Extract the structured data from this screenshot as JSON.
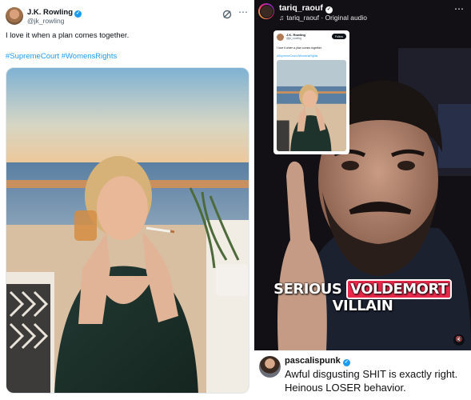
{
  "tweet": {
    "name": "J.K. Rowling",
    "handle": "@jk_rowling",
    "text": "I love it when a plan comes together.",
    "hashtags": "#SupremeCourt #WomensRights",
    "more_icon": "⋯",
    "verified_icon": "✓"
  },
  "reel": {
    "username": "tariq_raouf",
    "audio_note": "♫",
    "audio": "tariq_raouf · Original audio",
    "more_icon": "⋯",
    "verified_icon": "✓",
    "caption_pre": "SERIOUS ",
    "caption_highlight": "VOLDEMORT",
    "caption_post": " VILLAIN",
    "mute_icon": "🔇",
    "embedded": {
      "name": "J.K. Rowling",
      "handle": "@jk_rowling",
      "follow": "Follow",
      "text": "I love it when a plan comes together.",
      "hashtags": "#SupremeCourt #WomensRights"
    }
  },
  "comment": {
    "username": "pascalispunk",
    "verified_icon": "✓",
    "text": "Awful disgusting SHIT is exactly right. Heinous LOSER behavior."
  },
  "colors": {
    "link_blue": "#1d9bf0",
    "caption_highlight": "#e8294a",
    "video_bg": "#0e0d10"
  }
}
